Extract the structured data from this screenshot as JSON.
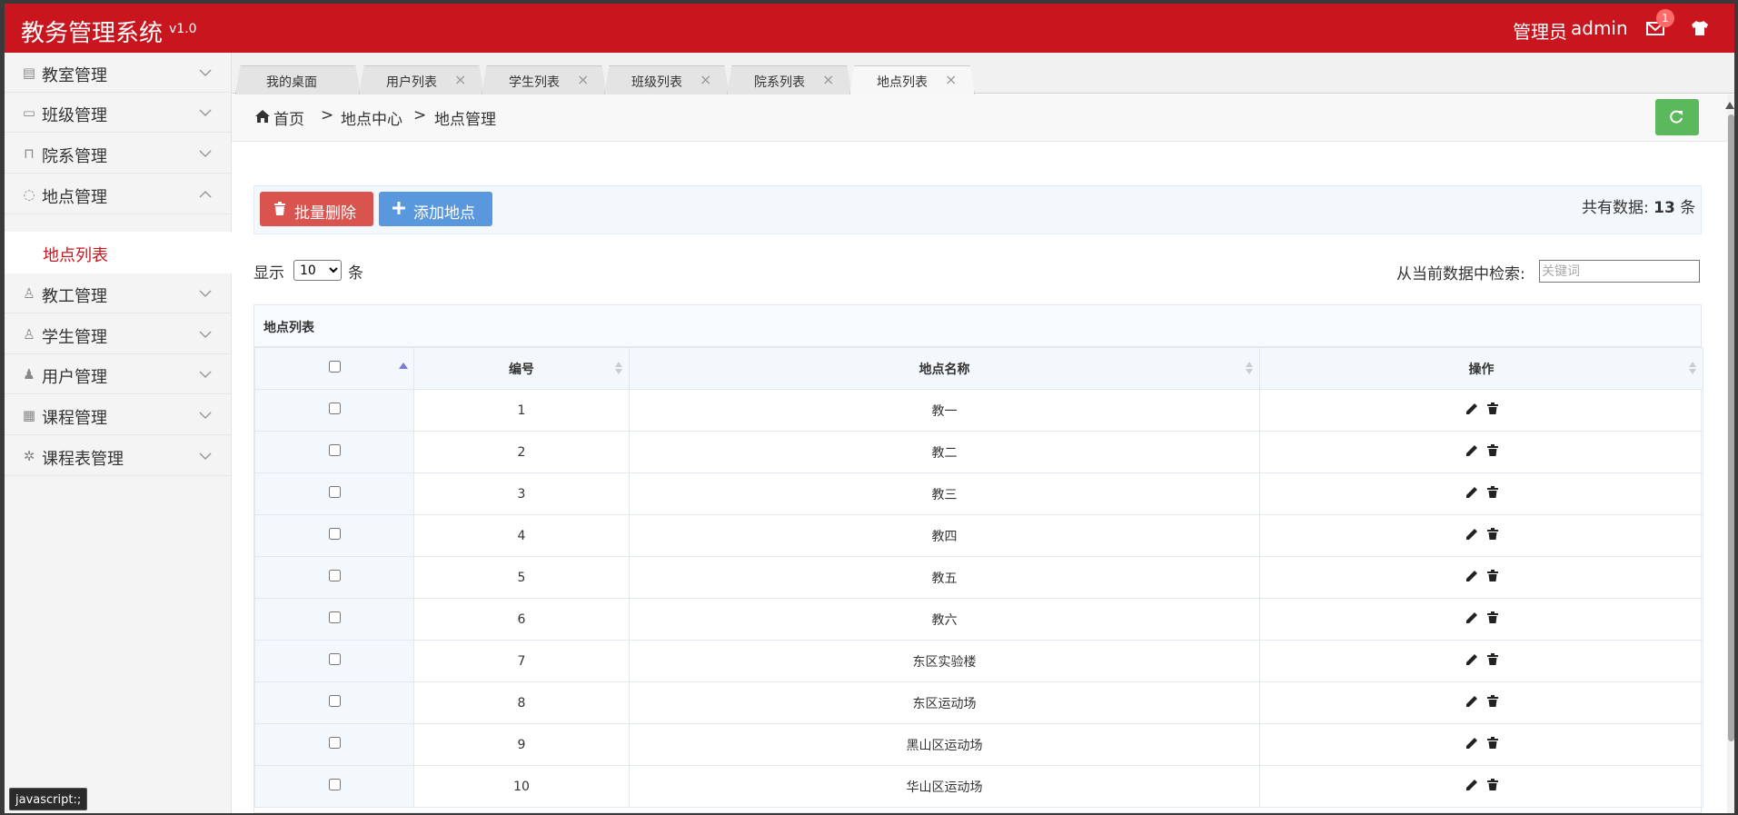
{
  "header": {
    "title": "教务管理系统",
    "version": "v1.0",
    "user_role": "管理员",
    "user_name": "admin",
    "mail_badge": "1",
    "icons": [
      "mail-icon",
      "shirt-icon"
    ]
  },
  "sidebar": {
    "items": [
      {
        "label": "教室管理",
        "icon": "classroom-icon"
      },
      {
        "label": "班级管理",
        "icon": "class-icon"
      },
      {
        "label": "院系管理",
        "icon": "department-icon"
      },
      {
        "label": "地点管理",
        "icon": "location-icon"
      },
      {
        "label": "教工管理",
        "icon": "staff-icon"
      },
      {
        "label": "学生管理",
        "icon": "student-icon"
      },
      {
        "label": "用户管理",
        "icon": "user-icon"
      },
      {
        "label": "课程管理",
        "icon": "course-icon"
      },
      {
        "label": "课程表管理",
        "icon": "timetable-icon"
      }
    ],
    "active_sub": "地点列表"
  },
  "tabs": [
    {
      "label": "我的桌面"
    },
    {
      "label": "用户列表"
    },
    {
      "label": "学生列表"
    },
    {
      "label": "班级列表"
    },
    {
      "label": "院系列表"
    },
    {
      "label": "地点列表",
      "active": true
    }
  ],
  "breadcrumb": {
    "home": "首页",
    "sep": ">",
    "level2": "地点中心",
    "level3": "地点管理"
  },
  "toolbar": {
    "batch_delete": "批量删除",
    "add": "添加地点",
    "total_prefix": "共有数据:",
    "total_count": "13",
    "total_suffix": "条"
  },
  "length_control": {
    "prefix": "显示",
    "selected": "10",
    "suffix": "条"
  },
  "search": {
    "label": "从当前数据中检索:",
    "placeholder": "关键词"
  },
  "table": {
    "caption": "地点列表",
    "columns": [
      "编号",
      "地点名称",
      "操作"
    ],
    "rows": [
      {
        "id": "1",
        "name": "教一"
      },
      {
        "id": "2",
        "name": "教二"
      },
      {
        "id": "3",
        "name": "教三"
      },
      {
        "id": "4",
        "name": "教四"
      },
      {
        "id": "5",
        "name": "教五"
      },
      {
        "id": "6",
        "name": "教六"
      },
      {
        "id": "7",
        "name": "东区实验楼"
      },
      {
        "id": "8",
        "name": "东区运动场"
      },
      {
        "id": "9",
        "name": "黑山区运动场"
      },
      {
        "id": "10",
        "name": "华山区运动场"
      }
    ]
  },
  "status_tip": "javascript:;",
  "colors": {
    "brand": "#c9161e",
    "danger": "#d9534f",
    "primary": "#5a98de",
    "success": "#5cb85c"
  }
}
